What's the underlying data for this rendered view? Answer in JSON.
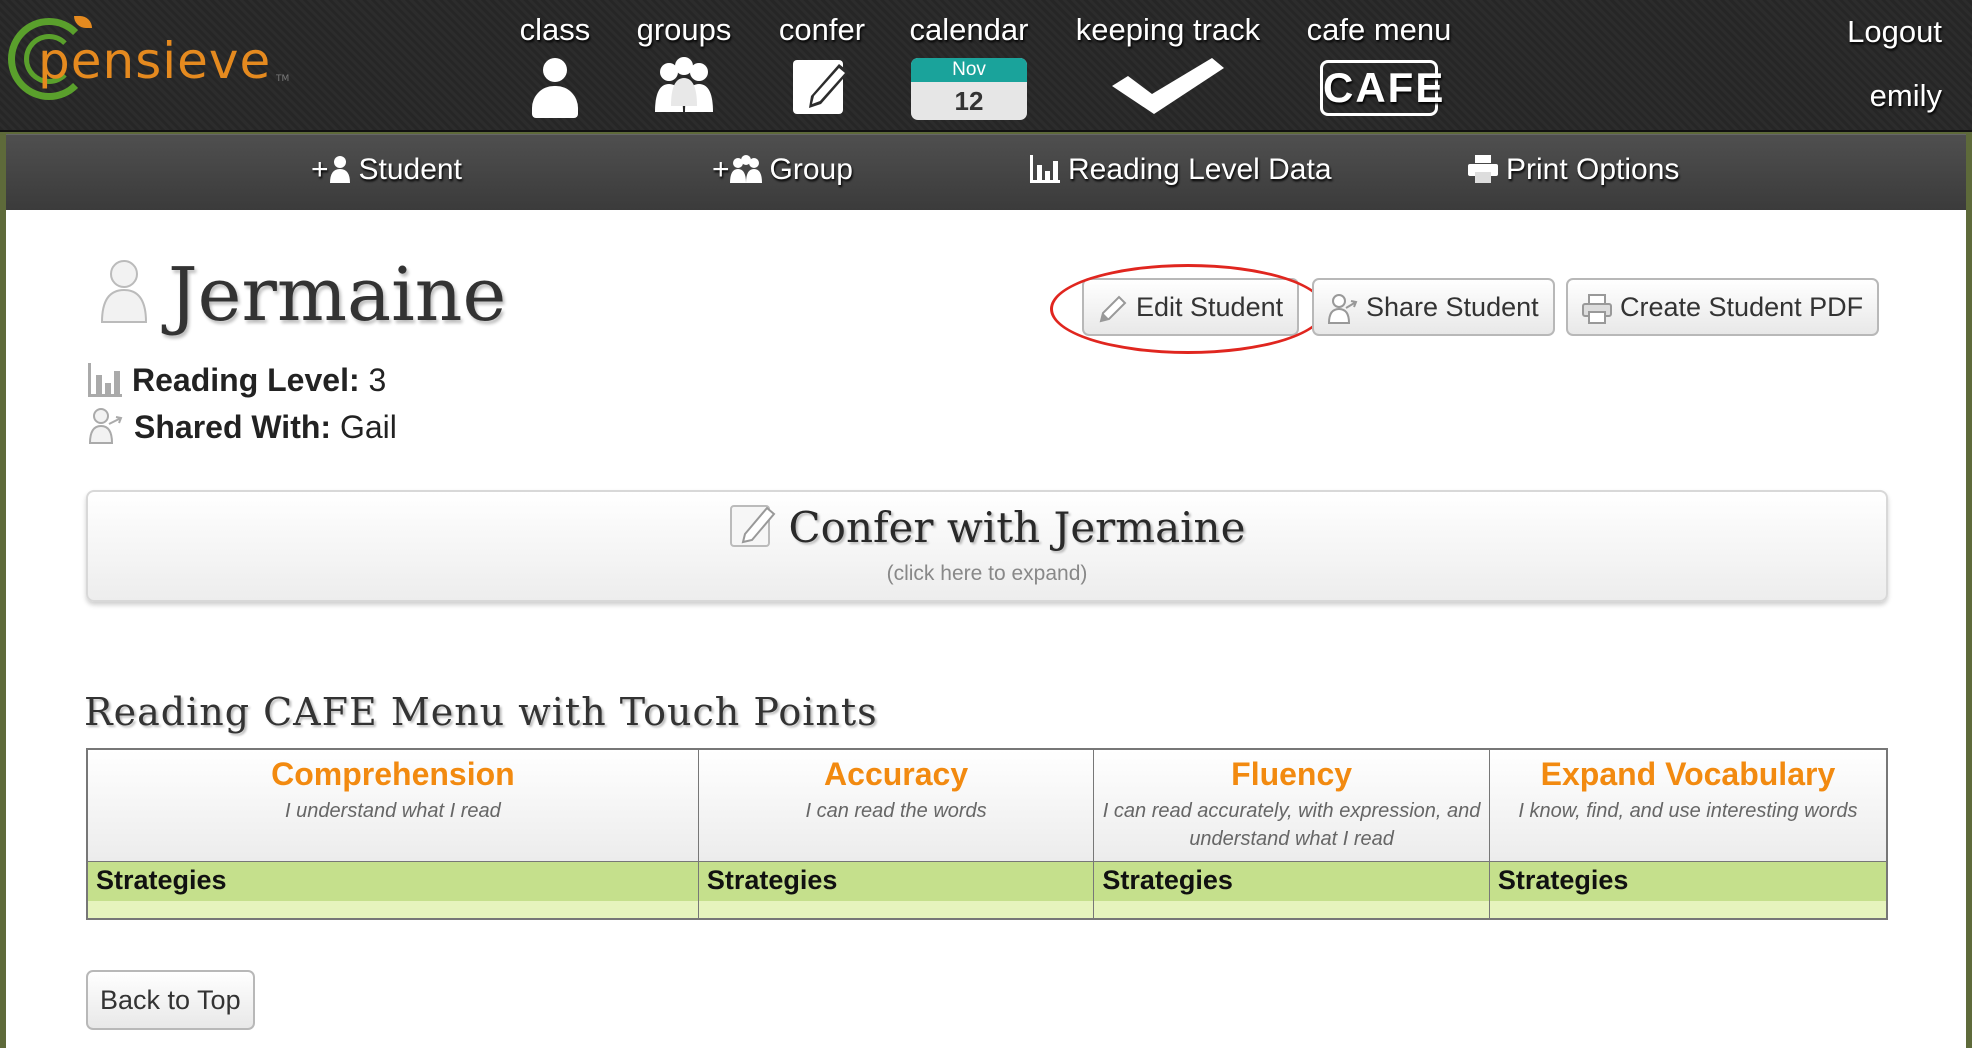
{
  "brand": {
    "logo_text": "pensieve",
    "tm": "TM"
  },
  "nav": {
    "items": [
      {
        "label": "class",
        "icon": "person-icon"
      },
      {
        "label": "groups",
        "icon": "group-icon"
      },
      {
        "label": "confer",
        "icon": "notepad-pencil-icon"
      },
      {
        "label": "calendar",
        "icon": "calendar-icon",
        "month": "Nov",
        "day": "12"
      },
      {
        "label": "keeping track",
        "icon": "checkmark-icon"
      },
      {
        "label": "cafe menu",
        "icon": "cafe-icon",
        "badge": "CAFE"
      }
    ],
    "logout": "Logout",
    "user": "emily"
  },
  "subnav": {
    "add_student": "Student",
    "add_group": "Group",
    "reading_level_data": "Reading Level Data",
    "print_options": "Print Options",
    "plus": "+"
  },
  "student": {
    "name": "Jermaine",
    "reading_level_label": "Reading Level:",
    "reading_level_value": "3",
    "shared_with_label": "Shared With:",
    "shared_with_value": "Gail"
  },
  "actions": {
    "edit": "Edit Student",
    "share": "Share Student",
    "pdf": "Create Student PDF"
  },
  "confer": {
    "title": "Confer with Jermaine",
    "hint": "(click here to expand)"
  },
  "cafe": {
    "section_title": "Reading CAFE Menu with Touch Points",
    "columns": [
      {
        "title": "Comprehension",
        "subtitle": "I understand what I read",
        "strategies": "Strategies"
      },
      {
        "title": "Accuracy",
        "subtitle": "I can read the words",
        "strategies": "Strategies"
      },
      {
        "title": "Fluency",
        "subtitle": "I can read accurately, with expression, and understand what I read",
        "strategies": "Strategies"
      },
      {
        "title": "Expand Vocabulary",
        "subtitle": "I know, find, and use interesting words",
        "strategies": "Strategies"
      }
    ]
  },
  "footer": {
    "back_to_top": "Back to Top"
  },
  "colors": {
    "accent_orange": "#f28a10",
    "strategy_green": "#c5e08c",
    "calendar_teal": "#1aa39b",
    "annotation_red": "#e0261f"
  }
}
